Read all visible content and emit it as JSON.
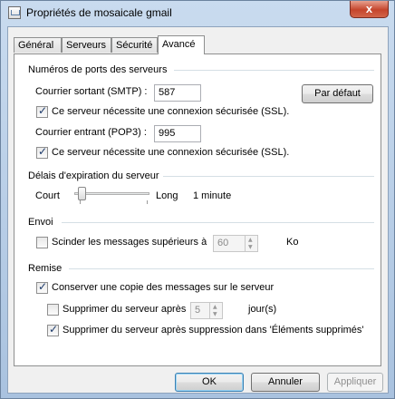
{
  "window": {
    "title": "Propriétés de mosaicale gmail",
    "close_glyph": "x"
  },
  "tabs": [
    "Général",
    "Serveurs",
    "Sécurité",
    "Avancé"
  ],
  "ports": {
    "group_title": "Numéros de ports des serveurs",
    "smtp_label": "Courrier sortant (SMTP) :",
    "smtp_value": "587",
    "default_button": "Par défaut",
    "smtp_ssl_label": "Ce serveur nécessite une connexion sécurisée (SSL).",
    "smtp_ssl_checked": true,
    "pop3_label": "Courrier entrant (POP3) :",
    "pop3_value": "995",
    "pop3_ssl_label": "Ce serveur nécessite une connexion sécurisée (SSL).",
    "pop3_ssl_checked": true
  },
  "timeout": {
    "group_title": "Délais d'expiration du serveur",
    "short_label": "Court",
    "long_label": "Long",
    "value_text": "1 minute",
    "slider_fraction": 0.05
  },
  "send": {
    "group_title": "Envoi",
    "split_label": "Scinder les messages supérieurs à",
    "split_checked": false,
    "split_value": "60",
    "split_unit": "Ko"
  },
  "delivery": {
    "group_title": "Remise",
    "keep_copy_label": "Conserver une copie des messages sur le serveur",
    "keep_copy_checked": true,
    "remove_after_label": "Supprimer du serveur après",
    "remove_after_checked": false,
    "remove_after_value": "5",
    "remove_after_unit": "jour(s)",
    "remove_deleted_label": "Supprimer du serveur après suppression dans 'Éléments supprimés'",
    "remove_deleted_checked": true
  },
  "buttons": {
    "ok": "OK",
    "cancel": "Annuler",
    "apply": "Appliquer"
  }
}
